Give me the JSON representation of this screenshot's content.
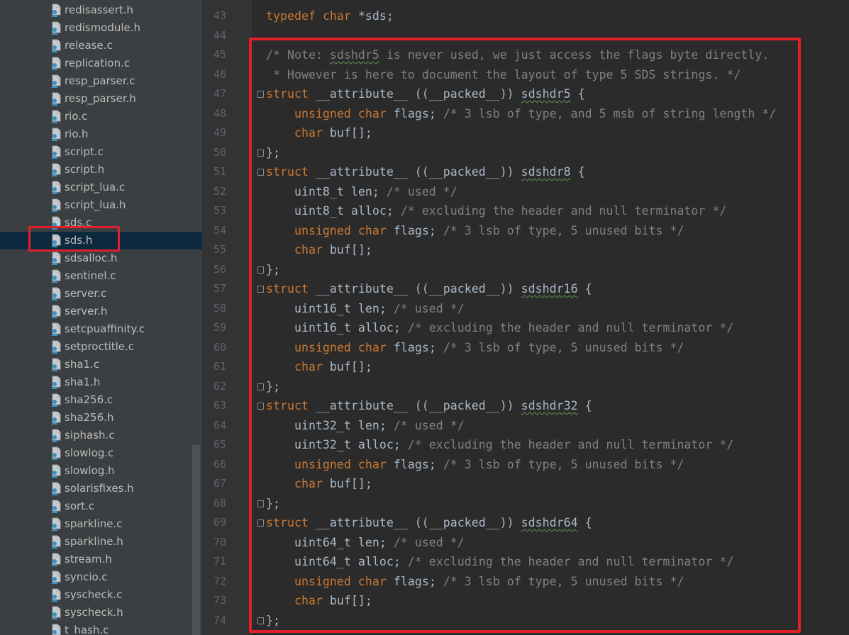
{
  "colors": {
    "keyword": "#cc7832",
    "comment": "#808080",
    "text": "#a9b7c6",
    "highlight_box": "#e0202a",
    "selected_row": "#0d293e"
  },
  "file_icon": "c-header-file-icon",
  "project_tree": {
    "selected": "sds.h",
    "files": [
      "redisassert.h",
      "redismodule.h",
      "release.c",
      "replication.c",
      "resp_parser.c",
      "resp_parser.h",
      "rio.c",
      "rio.h",
      "script.c",
      "script.h",
      "script_lua.c",
      "script_lua.h",
      "sds.c",
      "sds.h",
      "sdsalloc.h",
      "sentinel.c",
      "server.c",
      "server.h",
      "setcpuaffinity.c",
      "setproctitle.c",
      "sha1.c",
      "sha1.h",
      "sha256.c",
      "sha256.h",
      "siphash.c",
      "slowlog.c",
      "slowlog.h",
      "solarisfixes.h",
      "sort.c",
      "sparkline.c",
      "sparkline.h",
      "stream.h",
      "syncio.c",
      "syscheck.c",
      "syscheck.h",
      "t_hash.c"
    ]
  },
  "editor": {
    "lines": [
      {
        "n": "43",
        "tokens": [
          [
            "typedef",
            "kw"
          ],
          [
            " ",
            ""
          ],
          [
            "char",
            "kw"
          ],
          [
            " *sds;",
            ""
          ]
        ]
      },
      {
        "n": "44",
        "tokens": []
      },
      {
        "n": "45",
        "tokens": [
          [
            "/* Note: ",
            "cm"
          ],
          [
            "sdshdr5",
            "cmw"
          ],
          [
            " is never used, we just access the flags byte directly.",
            "cm"
          ]
        ]
      },
      {
        "n": "46",
        "tokens": [
          [
            " * However is here to document the layout of type 5 SDS strings. */",
            "cm"
          ]
        ]
      },
      {
        "n": "47",
        "fold": true,
        "tokens": [
          [
            "struct",
            "kw"
          ],
          [
            " __attribute__ ((__packed__)) ",
            ""
          ],
          [
            "sdshdr5",
            "w"
          ],
          [
            " {",
            ""
          ]
        ]
      },
      {
        "n": "48",
        "tokens": [
          [
            "    ",
            ""
          ],
          [
            "unsigned",
            "kw"
          ],
          [
            " ",
            ""
          ],
          [
            "char",
            "kw"
          ],
          [
            " flags; ",
            ""
          ],
          [
            "/* 3 lsb of type, and 5 msb of string length */",
            "cm"
          ]
        ]
      },
      {
        "n": "49",
        "tokens": [
          [
            "    ",
            ""
          ],
          [
            "char",
            "kw"
          ],
          [
            " buf[];",
            ""
          ]
        ]
      },
      {
        "n": "50",
        "fold": true,
        "tokens": [
          [
            "};",
            ""
          ]
        ]
      },
      {
        "n": "51",
        "fold": true,
        "tokens": [
          [
            "struct",
            "kw"
          ],
          [
            " __attribute__ ((__packed__)) ",
            ""
          ],
          [
            "sdshdr8",
            "w"
          ],
          [
            " {",
            ""
          ]
        ]
      },
      {
        "n": "52",
        "tokens": [
          [
            "    uint8_t len; ",
            ""
          ],
          [
            "/* used */",
            "cm"
          ]
        ]
      },
      {
        "n": "53",
        "tokens": [
          [
            "    uint8_t alloc; ",
            ""
          ],
          [
            "/* excluding the header and null terminator */",
            "cm"
          ]
        ]
      },
      {
        "n": "54",
        "tokens": [
          [
            "    ",
            ""
          ],
          [
            "unsigned",
            "kw"
          ],
          [
            " ",
            ""
          ],
          [
            "char",
            "kw"
          ],
          [
            " flags; ",
            ""
          ],
          [
            "/* 3 lsb of type, 5 unused bits */",
            "cm"
          ]
        ]
      },
      {
        "n": "55",
        "tokens": [
          [
            "    ",
            ""
          ],
          [
            "char",
            "kw"
          ],
          [
            " buf[];",
            ""
          ]
        ]
      },
      {
        "n": "56",
        "fold": true,
        "tokens": [
          [
            "};",
            ""
          ]
        ]
      },
      {
        "n": "57",
        "fold": true,
        "tokens": [
          [
            "struct",
            "kw"
          ],
          [
            " __attribute__ ((__packed__)) ",
            ""
          ],
          [
            "sdshdr16",
            "w"
          ],
          [
            " {",
            ""
          ]
        ]
      },
      {
        "n": "58",
        "tokens": [
          [
            "    uint16_t len; ",
            ""
          ],
          [
            "/* used */",
            "cm"
          ]
        ]
      },
      {
        "n": "59",
        "tokens": [
          [
            "    uint16_t alloc; ",
            ""
          ],
          [
            "/* excluding the header and null terminator */",
            "cm"
          ]
        ]
      },
      {
        "n": "60",
        "tokens": [
          [
            "    ",
            ""
          ],
          [
            "unsigned",
            "kw"
          ],
          [
            " ",
            ""
          ],
          [
            "char",
            "kw"
          ],
          [
            " flags; ",
            ""
          ],
          [
            "/* 3 lsb of type, 5 unused bits */",
            "cm"
          ]
        ]
      },
      {
        "n": "61",
        "tokens": [
          [
            "    ",
            ""
          ],
          [
            "char",
            "kw"
          ],
          [
            " buf[];",
            ""
          ]
        ]
      },
      {
        "n": "62",
        "fold": true,
        "tokens": [
          [
            "};",
            ""
          ]
        ]
      },
      {
        "n": "63",
        "fold": true,
        "tokens": [
          [
            "struct",
            "kw"
          ],
          [
            " __attribute__ ((__packed__)) ",
            ""
          ],
          [
            "sdshdr32",
            "w"
          ],
          [
            " {",
            ""
          ]
        ]
      },
      {
        "n": "64",
        "tokens": [
          [
            "    uint32_t len; ",
            ""
          ],
          [
            "/* used */",
            "cm"
          ]
        ]
      },
      {
        "n": "65",
        "tokens": [
          [
            "    uint32_t alloc; ",
            ""
          ],
          [
            "/* excluding the header and null terminator */",
            "cm"
          ]
        ]
      },
      {
        "n": "66",
        "tokens": [
          [
            "    ",
            ""
          ],
          [
            "unsigned",
            "kw"
          ],
          [
            " ",
            ""
          ],
          [
            "char",
            "kw"
          ],
          [
            " flags; ",
            ""
          ],
          [
            "/* 3 lsb of type, 5 unused bits */",
            "cm"
          ]
        ]
      },
      {
        "n": "67",
        "tokens": [
          [
            "    ",
            ""
          ],
          [
            "char",
            "kw"
          ],
          [
            " buf[];",
            ""
          ]
        ]
      },
      {
        "n": "68",
        "fold": true,
        "tokens": [
          [
            "};",
            ""
          ]
        ]
      },
      {
        "n": "69",
        "fold": true,
        "tokens": [
          [
            "struct",
            "kw"
          ],
          [
            " __attribute__ ((__packed__)) ",
            ""
          ],
          [
            "sdshdr64",
            "w"
          ],
          [
            " {",
            ""
          ]
        ]
      },
      {
        "n": "70",
        "tokens": [
          [
            "    uint64_t len; ",
            ""
          ],
          [
            "/* used */",
            "cm"
          ]
        ]
      },
      {
        "n": "71",
        "tokens": [
          [
            "    uint64_t alloc; ",
            ""
          ],
          [
            "/* excluding the header and null terminator */",
            "cm"
          ]
        ]
      },
      {
        "n": "72",
        "tokens": [
          [
            "    ",
            ""
          ],
          [
            "unsigned",
            "kw"
          ],
          [
            " ",
            ""
          ],
          [
            "char",
            "kw"
          ],
          [
            " flags; ",
            ""
          ],
          [
            "/* 3 lsb of type, 5 unused bits */",
            "cm"
          ]
        ]
      },
      {
        "n": "73",
        "tokens": [
          [
            "    ",
            ""
          ],
          [
            "char",
            "kw"
          ],
          [
            " buf[];",
            ""
          ]
        ]
      },
      {
        "n": "74",
        "fold": true,
        "tokens": [
          [
            "};",
            ""
          ]
        ]
      }
    ]
  }
}
